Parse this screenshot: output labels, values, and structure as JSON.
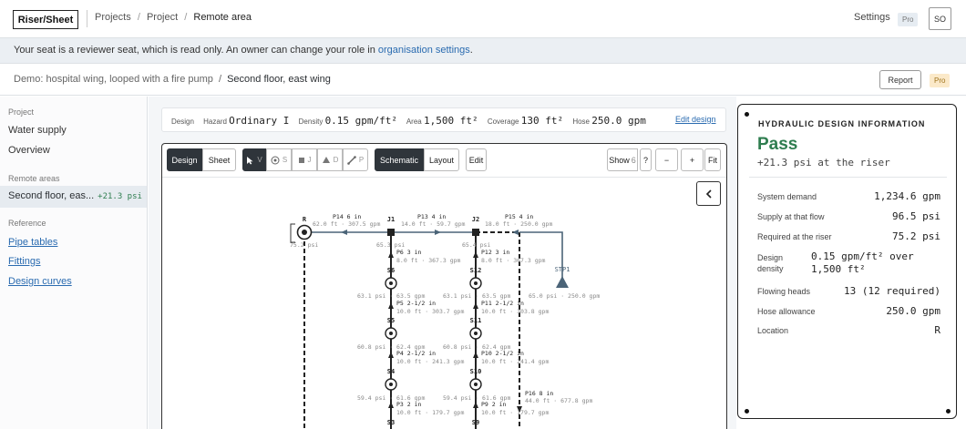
{
  "topbar": {
    "logo": "Riser/Sheet",
    "breadcrumbs": [
      "Projects",
      "Project",
      "Remote area"
    ],
    "separator": "/",
    "settings": "Settings",
    "pro_badge": "Pro",
    "avatar": "SO"
  },
  "banner": {
    "text": "Your seat is a reviewer seat, which is read only. An owner can change your role in",
    "link": "organisation settings",
    "end": "."
  },
  "demobar": {
    "project": "Demo: hospital wing, looped with a fire pump",
    "separator": "/",
    "area": "Second floor, east wing",
    "report": "Report",
    "pro_badge": "Pro"
  },
  "sidebar": {
    "project_label": "Project",
    "water_supply": "Water supply",
    "overview": "Overview",
    "remote_label": "Remote areas",
    "remote_item": "Second floor, eas...",
    "remote_psi": "+21.3 psi",
    "reference_label": "Reference",
    "pipe_tables": "Pipe tables",
    "fittings": "Fittings",
    "design_curves": "Design curves"
  },
  "design_strip": {
    "design": "Design",
    "hazard_label": "Hazard",
    "hazard_value": "Ordinary I",
    "density_label": "Density",
    "density_value": "0.15 gpm/ft²",
    "area_label": "Area",
    "area_value": "1,500 ft²",
    "coverage_label": "Coverage",
    "coverage_value": "130 ft²",
    "hose_label": "Hose",
    "hose_value": "250.0 gpm",
    "edit": "Edit design"
  },
  "toolbar": {
    "design": "Design",
    "sheet": "Sheet",
    "tools": [
      "V",
      "S",
      "J",
      "D",
      "P"
    ],
    "schematic": "Schematic",
    "layout": "Layout",
    "edit": "Edit",
    "show": "Show",
    "show_count": "6",
    "help": "?",
    "zoom_out": "−",
    "zoom_in": "+",
    "fit": "Fit"
  },
  "schematic": {
    "nodes": {
      "R": "R",
      "J1": "J1",
      "J2": "J2",
      "STP1": "STP1",
      "S6": "S6",
      "S5": "S5",
      "S4": "S4",
      "S3": "S3",
      "S12": "S12",
      "S11": "S11",
      "S10": "S10",
      "S9": "S9"
    },
    "pipes": {
      "P14": {
        "name": "P14 6 in",
        "detail": "62.0 ft · 307.5 gpm"
      },
      "P13": {
        "name": "P13 4 in",
        "detail": "14.0 ft · 59.7 gpm"
      },
      "P15": {
        "name": "P15 4 in",
        "detail": "18.0 ft · 250.0 gpm"
      },
      "P6": {
        "name": "P6 3 in",
        "detail": "8.0 ft · 367.3 gpm"
      },
      "P12": {
        "name": "P12 3 in",
        "detail": "8.0 ft · 367.3 gpm"
      },
      "P5": {
        "name": "P5 2-1/2 in",
        "detail": "10.0 ft · 303.7 gpm"
      },
      "P11": {
        "name": "P11 2-1/2 in",
        "detail": "10.0 ft · 303.8 gpm"
      },
      "P4": {
        "name": "P4 2-1/2 in",
        "detail": "10.0 ft · 241.3 gpm"
      },
      "P10": {
        "name": "P10 2-1/2 in",
        "detail": "10.0 ft · 241.4 gpm"
      },
      "P3": {
        "name": "P3 2 in",
        "detail": "10.0 ft · 179.7 gpm"
      },
      "P9": {
        "name": "P9 2 in",
        "detail": "10.0 ft · 179.7 gpm"
      },
      "P16": {
        "name": "P16 8 in",
        "detail": "44.0 ft · 677.8 gpm"
      }
    },
    "readings": {
      "r": "75.2 psi",
      "j1": "65.3 psi",
      "j2": "65.4 psi",
      "s6": "63.1 psi · 63.5 gpm",
      "s12": "63.1 psi · 63.5 gpm",
      "stp": "65.0 psi · 250.0 gpm",
      "s5": "60.8 psi · 62.4 gpm",
      "s11": "60.8 psi · 62.4 gpm",
      "s4": "59.4 psi · 61.6 gpm",
      "s10": "59.4 psi · 61.6 gpm"
    }
  },
  "info": {
    "title": "HYDRAULIC DESIGN INFORMATION",
    "status": "Pass",
    "status_sub": "+21.3 psi at the riser",
    "rows": [
      {
        "label": "System demand",
        "value": "1,234.6 gpm"
      },
      {
        "label": "Supply at that flow",
        "value": "96.5 psi"
      },
      {
        "label": "Required at the riser",
        "value": "75.2 psi"
      },
      {
        "label": "Design density",
        "value": "0.15 gpm/ft² over 1,500 ft²"
      },
      {
        "label": "Flowing heads",
        "value": "13 (12 required)"
      },
      {
        "label": "Hose allowance",
        "value": "250.0 gpm"
      },
      {
        "label": "Location",
        "value": "R"
      }
    ]
  },
  "colors": {
    "pass": "#2e7d4f",
    "link": "#2a6bb0",
    "pipe_blue": "#4b6478",
    "dark": "#2f353b"
  }
}
